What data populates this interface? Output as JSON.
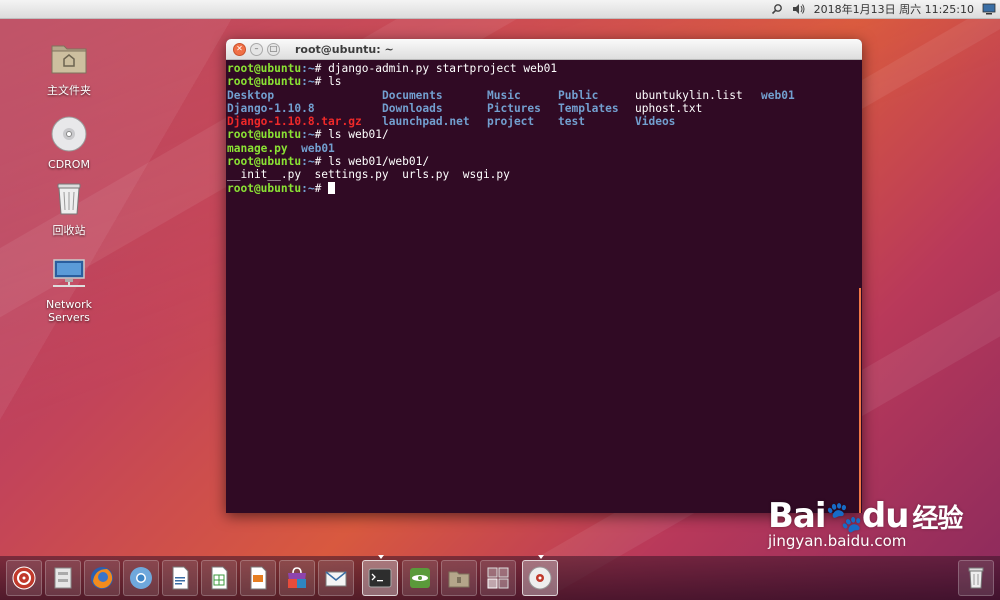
{
  "top_panel": {
    "datetime": "2018年1月13日 周六 11:25:10"
  },
  "desktop_icons": [
    {
      "label": "主文件夹",
      "icon": "home-folder-icon"
    },
    {
      "label": "CDROM",
      "icon": "cdrom-icon"
    },
    {
      "label": "回收站",
      "icon": "trash-icon"
    },
    {
      "label": "Network Servers",
      "icon": "network-servers-icon"
    }
  ],
  "terminal": {
    "title": "root@ubuntu: ~",
    "prompt_user": "root@ubuntu",
    "prompt_path": ":~",
    "prompt_symbol": "# ",
    "cmd1": "django-admin.py startproject web01",
    "cmd2": "ls",
    "ls_row1": [
      "Desktop",
      "Documents",
      "Music",
      "Public",
      "ubuntukylin.list",
      "web01"
    ],
    "ls_row2": [
      "Django-1.10.8",
      "Downloads",
      "Pictures",
      "Templates",
      "uphost.txt"
    ],
    "ls_row3": [
      "Django-1.10.8.tar.gz",
      "launchpad.net",
      "project",
      "test",
      "Videos"
    ],
    "cmd3": "ls web01/",
    "out3a": "manage.py",
    "out3b": "web01",
    "cmd4": "ls web01/web01/",
    "out4": "__init__.py  settings.py  urls.py  wsgi.py"
  },
  "dock_items": [
    "ubuntu-kylin-home-icon",
    "file-manager-icon",
    "firefox-icon",
    "chromium-icon",
    "libreoffice-writer-icon",
    "libreoffice-calc-icon",
    "libreoffice-impress-icon",
    "software-center-icon",
    "mail-icon",
    "terminal-icon",
    "network-tool-icon",
    "archive-icon",
    "workspace-switcher-icon",
    "cdrom-icon"
  ],
  "watermark": {
    "brand": "Bai",
    "brand_mid": "du",
    "brand_cn": "经验",
    "url": "jingyan.baidu.com"
  }
}
